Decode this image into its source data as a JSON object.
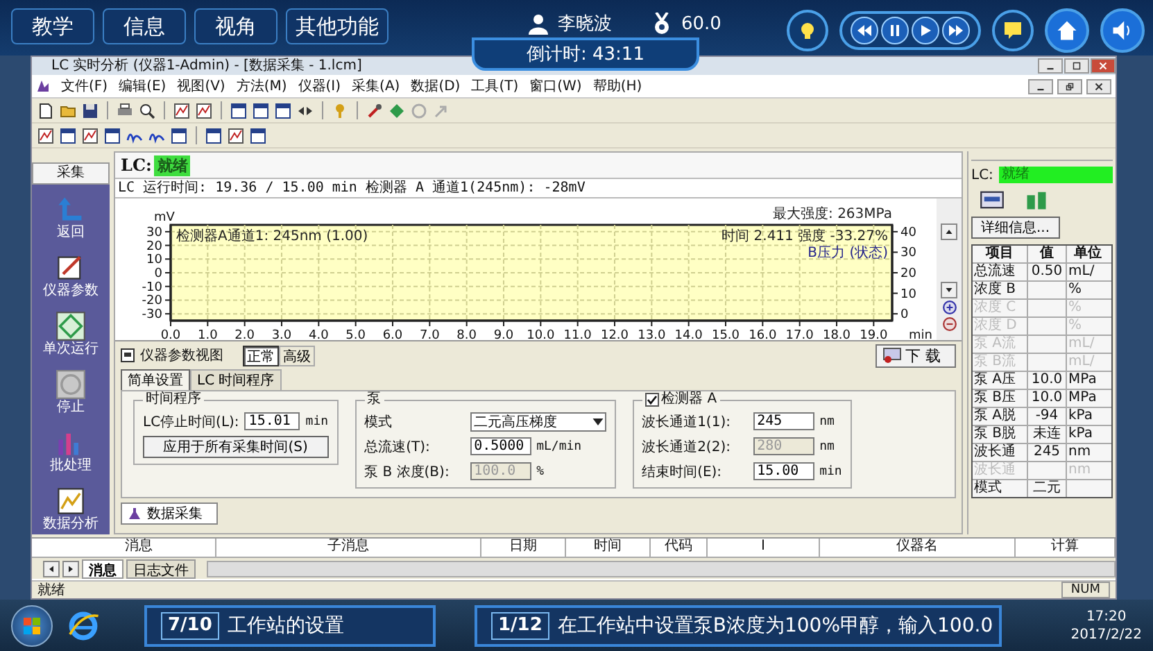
{
  "top_tabs": [
    {
      "label": "教学"
    },
    {
      "label": "信息"
    },
    {
      "label": "视角"
    },
    {
      "label": "其他功能"
    }
  ],
  "user": {
    "name": "李晓波",
    "score": "60.0",
    "countdown": "倒计时: 43:11"
  },
  "window": {
    "title": "LC 实时分析 (仪器1-Admin) - [数据采集 - 1.lcm]"
  },
  "menu": [
    "文件(F)",
    "编辑(E)",
    "视图(V)",
    "方法(M)",
    "仪器(I)",
    "采集(A)",
    "数据(D)",
    "工具(T)",
    "窗口(W)",
    "帮助(H)"
  ],
  "sidebar": {
    "title": "采集",
    "items": [
      {
        "label": "返回",
        "kind": "return"
      },
      {
        "label": "仪器参数",
        "kind": "params"
      },
      {
        "label": "单次运行",
        "kind": "run"
      },
      {
        "label": "停止",
        "kind": "stop"
      },
      {
        "label": "批处理",
        "kind": "batch"
      },
      {
        "label": "数据分析",
        "kind": "analysis"
      }
    ]
  },
  "status": {
    "label": "LC:",
    "value": "就绪"
  },
  "run_info": "LC 运行时间: 19.36 / 15.00 min 检测器 A 通道1(245nm): -28mV",
  "chart": {
    "legend": "检测器A通道1: 245nm (1.00)",
    "max_label": "最大强度: 263MPa",
    "cursor": "时间 2.411  强度   -33.27%",
    "right_axis_label": "B压力 (状态)",
    "right_ticks": [
      "40",
      "30",
      "20",
      "10",
      "0"
    ],
    "chart_data": {
      "type": "line",
      "grid": true,
      "xlabel": "min",
      "ylabel": "mV",
      "xlim": [
        0,
        19.5
      ],
      "ylim": [
        -35,
        35
      ],
      "xticks": [
        {
          "value": 0,
          "label": "0.0"
        },
        {
          "value": 1,
          "label": "1.0"
        },
        {
          "value": 2,
          "label": "2.0"
        },
        {
          "value": 3,
          "label": "3.0"
        },
        {
          "value": 4,
          "label": "4.0"
        },
        {
          "value": 5,
          "label": "5.0"
        },
        {
          "value": 6,
          "label": "6.0"
        },
        {
          "value": 7,
          "label": "7.0"
        },
        {
          "value": 8,
          "label": "8.0"
        },
        {
          "value": 9,
          "label": "9.0"
        },
        {
          "value": 10,
          "label": "10.0"
        },
        {
          "value": 11,
          "label": "11.0"
        },
        {
          "value": 12,
          "label": "12.0"
        },
        {
          "value": 13,
          "label": "13.0"
        },
        {
          "value": 14,
          "label": "14.0"
        },
        {
          "value": 15,
          "label": "15.0"
        },
        {
          "value": 16,
          "label": "16.0"
        },
        {
          "value": 17,
          "label": "17.0"
        },
        {
          "value": 18,
          "label": "18.0"
        },
        {
          "value": 19,
          "label": "19.0"
        }
      ],
      "yticks": [
        30,
        20,
        10,
        0,
        -10,
        -20,
        -30
      ]
    }
  },
  "param_panel": {
    "title": "仪器参数视图",
    "modes": [
      {
        "label": "正常",
        "selected": true
      },
      {
        "label": "高级",
        "selected": false
      }
    ],
    "tabs": [
      {
        "label": "简单设置",
        "selected": true
      },
      {
        "label": "LC 时间程序",
        "selected": false
      }
    ],
    "download": "下 载",
    "time_group": {
      "title": "时间程序",
      "stop_label": "LC停止时间(L):",
      "stop_value": "15.01",
      "stop_unit": "min",
      "apply_button": "应用于所有采集时间(S)"
    },
    "pump_group": {
      "title": "泵",
      "mode_label": "模式",
      "mode_value": "二元高压梯度",
      "fields": [
        {
          "label": "总流速(T):",
          "value": "0.5000",
          "unit": "mL/min",
          "disabled": false
        },
        {
          "label": "泵 B 浓度(B):",
          "value": "100.0",
          "unit": "%",
          "disabled": true
        }
      ]
    },
    "detector_group": {
      "title": "检测器 A",
      "checked": true,
      "fields": [
        {
          "label": "波长通道1(1):",
          "value": "245",
          "unit": "nm",
          "disabled": false
        },
        {
          "label": "波长通道2(2):",
          "value": "280",
          "unit": "nm",
          "disabled": true
        },
        {
          "label": "结束时间(E):",
          "value": "15.00",
          "unit": "min",
          "disabled": false
        }
      ]
    }
  },
  "bottom_tab": "数据采集",
  "right_panel": {
    "label": "LC:",
    "status": "就绪",
    "details_button": "详细信息...",
    "columns": [
      "项目",
      "值",
      "单位"
    ],
    "rows": [
      {
        "item": "总流速",
        "value": "0.50",
        "unit": "mL/",
        "disabled": false
      },
      {
        "item": "浓度 B",
        "value": "",
        "unit": "%",
        "disabled": false
      },
      {
        "item": "浓度 C",
        "value": "",
        "unit": "%",
        "disabled": true
      },
      {
        "item": "浓度 D",
        "value": "",
        "unit": "%",
        "disabled": true
      },
      {
        "item": "泵 A流",
        "value": "",
        "unit": "mL/",
        "disabled": true
      },
      {
        "item": "泵 B流",
        "value": "",
        "unit": "mL/",
        "disabled": true
      },
      {
        "item": "泵 A压",
        "value": "10.0",
        "unit": "MPa",
        "disabled": false
      },
      {
        "item": "泵 B压",
        "value": "10.0",
        "unit": "MPa",
        "disabled": false
      },
      {
        "item": "泵 A脱",
        "value": "-94",
        "unit": "kPa",
        "disabled": false
      },
      {
        "item": "泵 B脱",
        "value": "未连",
        "unit": "kPa",
        "disabled": false
      },
      {
        "item": "波长通",
        "value": "245",
        "unit": "nm",
        "disabled": false
      },
      {
        "item": "波长通",
        "value": "",
        "unit": "nm",
        "disabled": true
      },
      {
        "item": "模式",
        "value": "二元",
        "unit": "",
        "disabled": false
      }
    ]
  },
  "messages": {
    "columns": [
      "消息",
      "子消息",
      "日期",
      "时间",
      "代码",
      "I",
      "仪器名",
      "计算"
    ],
    "tabs": [
      {
        "label": "消息",
        "selected": true
      },
      {
        "label": "日志文件",
        "selected": false
      }
    ]
  },
  "status_bar": {
    "text": "就绪",
    "num": "NUM"
  },
  "taskbar": {
    "time": "17:20",
    "date": "2017/2/22"
  },
  "hints": [
    {
      "step": "7/10",
      "text": "工作站的设置"
    },
    {
      "step": "1/12",
      "text": "在工作站中设置泵B浓度为100%甲醇，输入100.0"
    }
  ]
}
